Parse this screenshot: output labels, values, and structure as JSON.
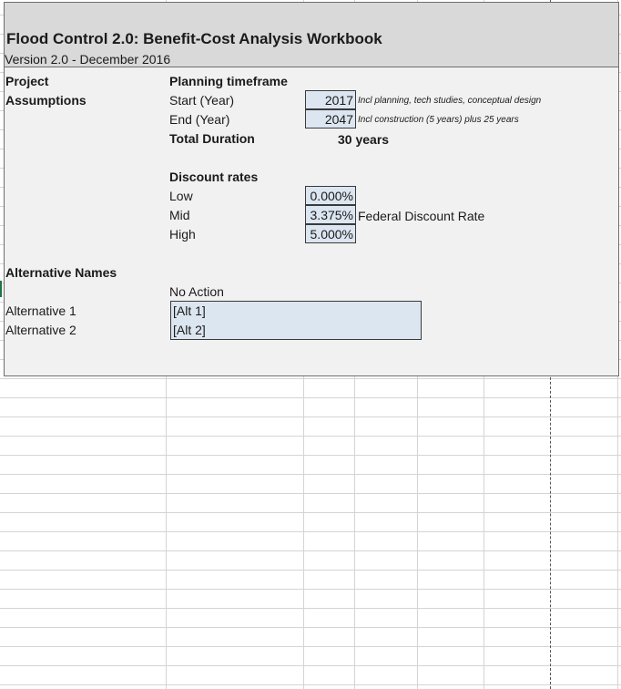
{
  "workbook": {
    "title": "Flood Control 2.0: Benefit-Cost Analysis Workbook",
    "version": "Version 2.0 - December 2016"
  },
  "project_assumptions": {
    "label_line1": "Project",
    "label_line2": "Assumptions",
    "planning": {
      "heading": "Planning timeframe",
      "start_label": "Start (Year)",
      "start_value": "2017",
      "start_note": "Incl planning, tech studies, conceptual design",
      "end_label": "End (Year)",
      "end_value": "2047",
      "end_note": "Incl construction (5 years) plus 25 years",
      "total_label": "Total Duration",
      "total_value": "30 years"
    },
    "discount": {
      "heading": "Discount rates",
      "low_label": "Low",
      "low_value": "0.000%",
      "mid_label": "Mid",
      "mid_value": "3.375%",
      "mid_note": "Federal Discount Rate",
      "high_label": "High",
      "high_value": "5.000%"
    }
  },
  "alternatives": {
    "heading": "Alternative Names",
    "no_action": "No Action",
    "alt1_label": "Alternative 1",
    "alt1_value": "[Alt 1]",
    "alt2_label": "Alternative 2",
    "alt2_value": "[Alt 2]"
  },
  "colors": {
    "header_band": "#d9d9d9",
    "panel": "#f1f1f1",
    "input_fill": "#dce6f1",
    "gridline": "#d4d4d4"
  }
}
